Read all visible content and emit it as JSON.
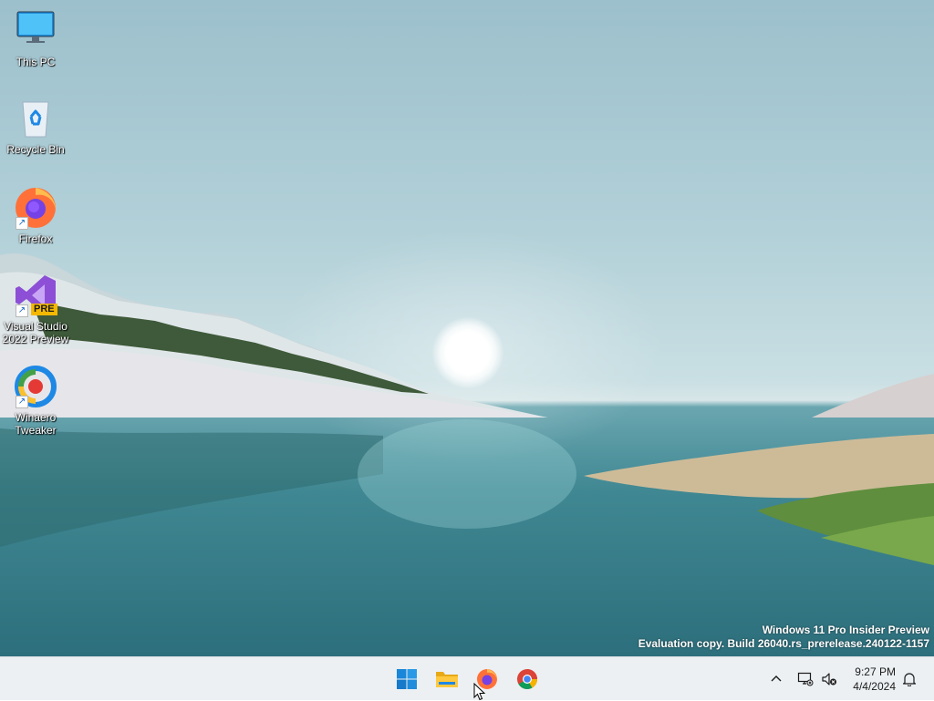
{
  "desktop": {
    "icons": [
      {
        "label": "This PC",
        "icon": "monitor-icon"
      },
      {
        "label": "Recycle Bin",
        "icon": "recycle-bin-icon"
      },
      {
        "label": "Firefox",
        "icon": "firefox-icon",
        "shortcut": true
      },
      {
        "label": "Visual Studio\n2022 Preview",
        "icon": "visual-studio-preview-icon",
        "badge": "PRE",
        "shortcut": true
      },
      {
        "label": "Winaero\nTweaker",
        "icon": "winaero-tweaker-icon",
        "shortcut": true
      }
    ],
    "watermark": {
      "line1": "Windows 11 Pro Insider Preview",
      "line2": "Evaluation copy. Build 26040.rs_prerelease.240122-1157"
    }
  },
  "taskbar": {
    "pinned": [
      "start-icon",
      "file-explorer-icon",
      "firefox-icon",
      "chrome-icon"
    ],
    "tray": {
      "overflow_icon": "chevron-up-icon",
      "network_icon": "network-icon",
      "volume_icon": "volume-muted-icon",
      "notification_icon": "bell-icon"
    },
    "clock": {
      "time": "9:27 PM",
      "date": "4/4/2024"
    }
  },
  "colors": {
    "taskbar_bg": "#ecf0f3",
    "start_blue": "#0078d4",
    "text_white": "#ffffff"
  }
}
